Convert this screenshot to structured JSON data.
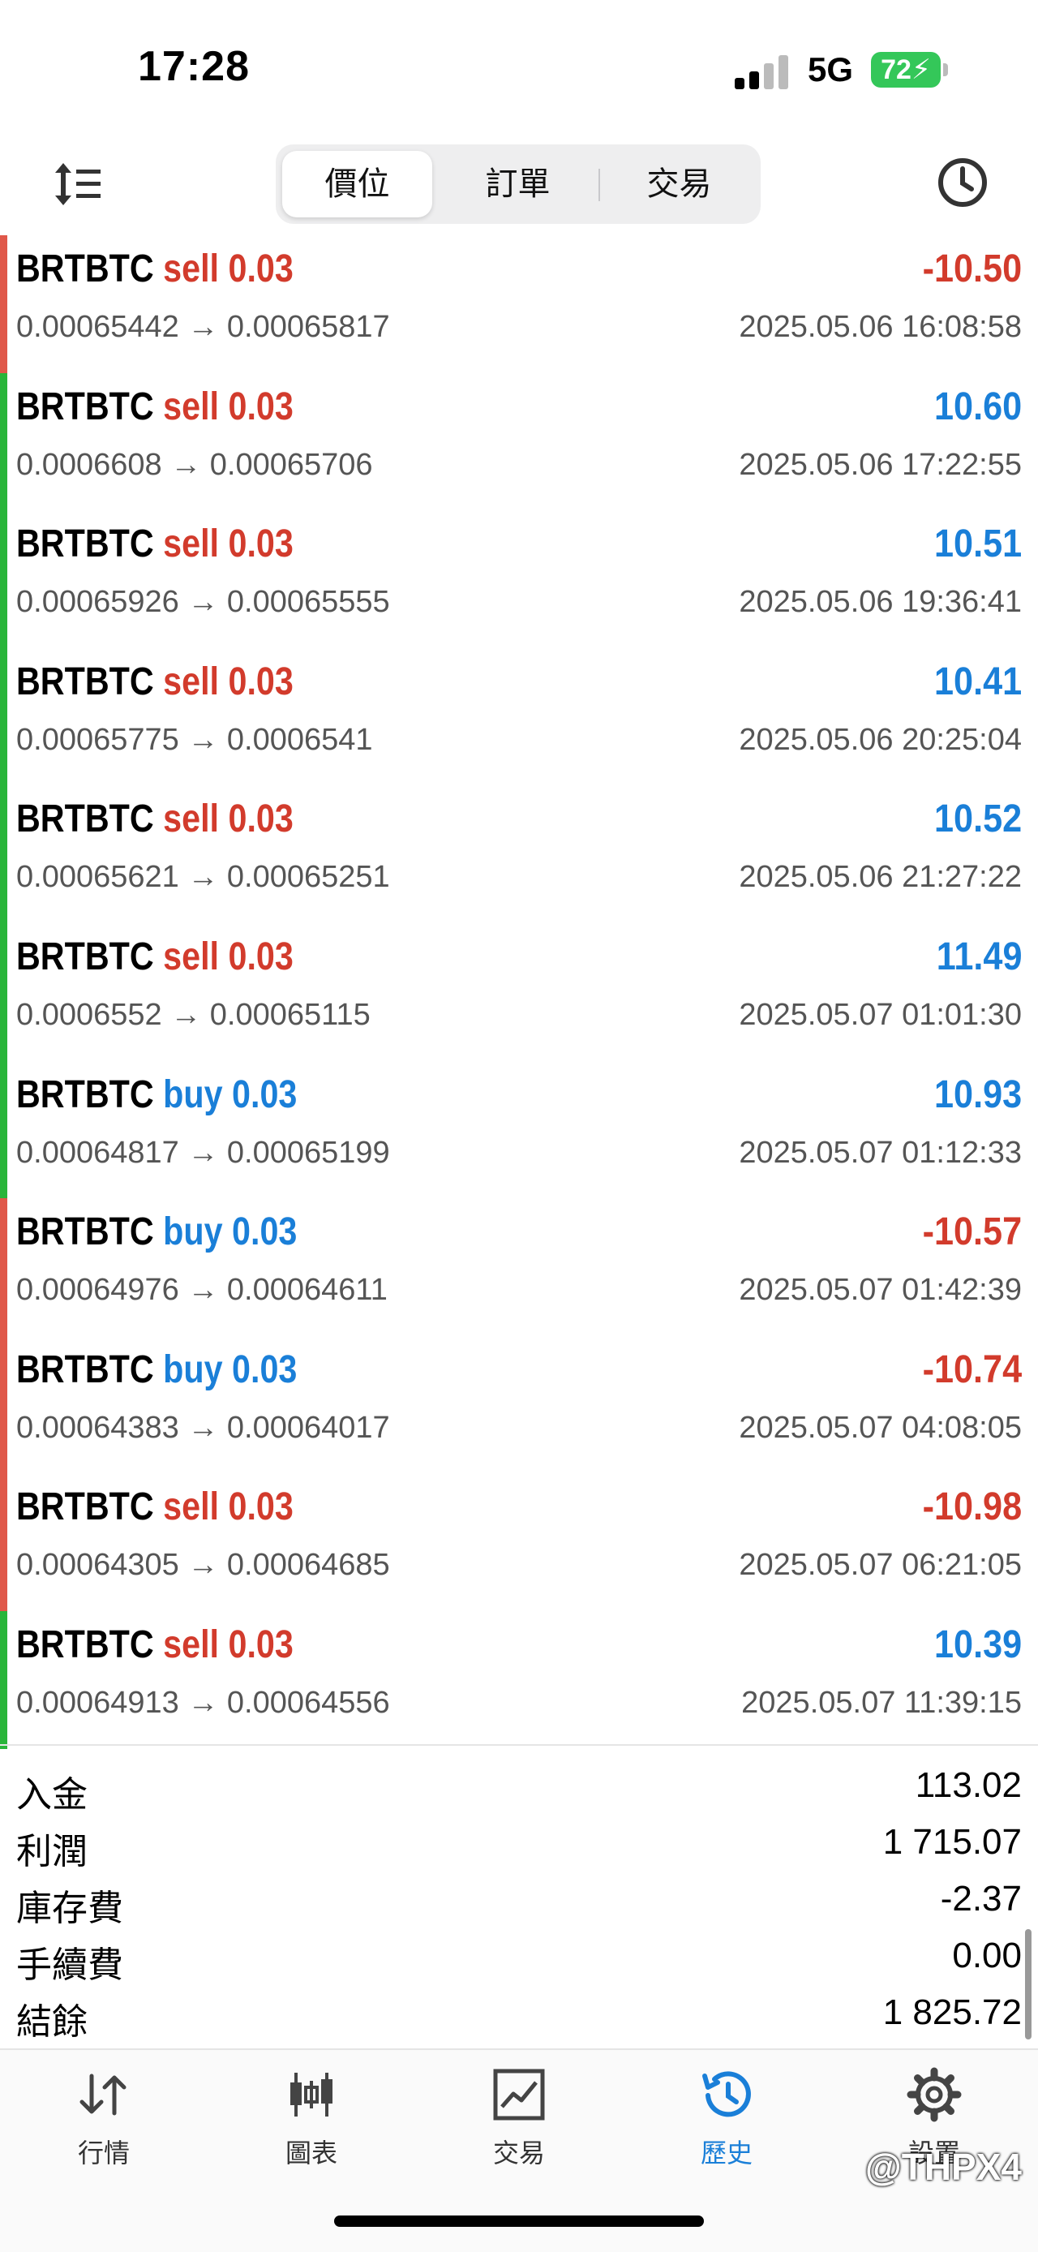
{
  "status": {
    "time": "17:28",
    "network": "5G",
    "battery": "72"
  },
  "toolbar": {
    "tabs": [
      "價位",
      "訂單",
      "交易"
    ]
  },
  "trades": [
    {
      "symbol": "BRTBTC",
      "side": "sell",
      "volume": "0.03",
      "open": "0.00065442",
      "close": "0.00065817",
      "arrow": "→",
      "profit": "-10.50",
      "time": "2025.05.06 16:08:58",
      "result": "loss"
    },
    {
      "symbol": "BRTBTC",
      "side": "sell",
      "volume": "0.03",
      "open": "0.0006608",
      "close": "0.00065706",
      "arrow": "→",
      "profit": "10.60",
      "time": "2025.05.06 17:22:55",
      "result": "win"
    },
    {
      "symbol": "BRTBTC",
      "side": "sell",
      "volume": "0.03",
      "open": "0.00065926",
      "close": "0.00065555",
      "arrow": "→",
      "profit": "10.51",
      "time": "2025.05.06 19:36:41",
      "result": "win"
    },
    {
      "symbol": "BRTBTC",
      "side": "sell",
      "volume": "0.03",
      "open": "0.00065775",
      "close": "0.0006541",
      "arrow": "→",
      "profit": "10.41",
      "time": "2025.05.06 20:25:04",
      "result": "win"
    },
    {
      "symbol": "BRTBTC",
      "side": "sell",
      "volume": "0.03",
      "open": "0.00065621",
      "close": "0.00065251",
      "arrow": "→",
      "profit": "10.52",
      "time": "2025.05.06 21:27:22",
      "result": "win"
    },
    {
      "symbol": "BRTBTC",
      "side": "sell",
      "volume": "0.03",
      "open": "0.0006552",
      "close": "0.00065115",
      "arrow": "→",
      "profit": "11.49",
      "time": "2025.05.07 01:01:30",
      "result": "win"
    },
    {
      "symbol": "BRTBTC",
      "side": "buy",
      "volume": "0.03",
      "open": "0.00064817",
      "close": "0.00065199",
      "arrow": "→",
      "profit": "10.93",
      "time": "2025.05.07 01:12:33",
      "result": "win"
    },
    {
      "symbol": "BRTBTC",
      "side": "buy",
      "volume": "0.03",
      "open": "0.00064976",
      "close": "0.00064611",
      "arrow": "→",
      "profit": "-10.57",
      "time": "2025.05.07 01:42:39",
      "result": "loss"
    },
    {
      "symbol": "BRTBTC",
      "side": "buy",
      "volume": "0.03",
      "open": "0.00064383",
      "close": "0.00064017",
      "arrow": "→",
      "profit": "-10.74",
      "time": "2025.05.07 04:08:05",
      "result": "loss"
    },
    {
      "symbol": "BRTBTC",
      "side": "sell",
      "volume": "0.03",
      "open": "0.00064305",
      "close": "0.00064685",
      "arrow": "→",
      "profit": "-10.98",
      "time": "2025.05.07 06:21:05",
      "result": "loss"
    },
    {
      "symbol": "BRTBTC",
      "side": "sell",
      "volume": "0.03",
      "open": "0.00064913",
      "close": "0.00064556",
      "arrow": "→",
      "profit": "10.39",
      "time": "2025.05.07 11:39:15",
      "result": "win"
    }
  ],
  "summary": [
    {
      "label": "入金",
      "value": "113.02"
    },
    {
      "label": "利潤",
      "value": "1 715.07"
    },
    {
      "label": "庫存費",
      "value": "-2.37"
    },
    {
      "label": "手續費",
      "value": "0.00"
    },
    {
      "label": "結餘",
      "value": "1 825.72"
    }
  ],
  "tabbar": [
    {
      "label": "行情",
      "icon": "quotes-arrows-icon",
      "active": false
    },
    {
      "label": "圖表",
      "icon": "candlestick-chart-icon",
      "active": false
    },
    {
      "label": "交易",
      "icon": "trade-chart-icon",
      "active": false
    },
    {
      "label": "歷史",
      "icon": "history-clock-icon",
      "active": true
    },
    {
      "label": "設置",
      "icon": "settings-gear-icon",
      "active": false
    }
  ],
  "watermark": "@THPX4",
  "colors": {
    "sell": "#d23b2c",
    "buy": "#1a7fd8",
    "loss_bar": "#e0584a",
    "win_bar": "#29b53a",
    "accent": "#1a7fd8"
  }
}
